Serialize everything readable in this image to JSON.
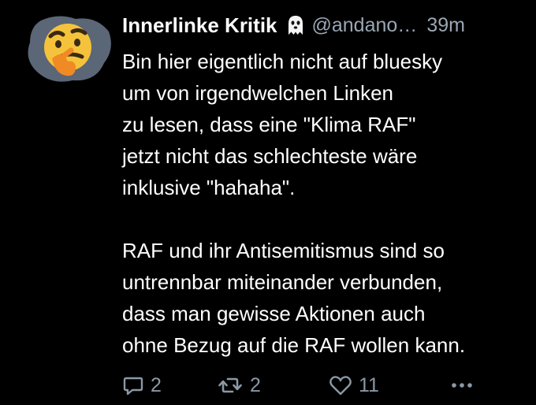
{
  "post": {
    "author": {
      "display_name": "Innerlinke Kritik",
      "badge_icon": "ghost-icon",
      "handle": "@andano…"
    },
    "time_ago": "39m",
    "paragraphs": [
      {
        "lines": [
          "Bin hier eigentlich nicht auf bluesky",
          "um von irgendwelchen Linken",
          "zu lesen, dass eine \"Klima RAF\"",
          "jetzt nicht das schlechteste wäre",
          "inklusive \"hahaha\"."
        ]
      },
      {
        "lines": [
          "RAF und ihr Antisemitismus sind so",
          "untrennbar miteinander verbunden,",
          "dass man gewisse Aktionen auch",
          "ohne Bezug auf die RAF wollen kann."
        ]
      }
    ],
    "actions": {
      "reply": {
        "icon": "reply-icon",
        "count": "2"
      },
      "repost": {
        "icon": "repost-icon",
        "count": "2"
      },
      "like": {
        "icon": "heart-icon",
        "count": "11"
      },
      "more": {
        "icon": "more-icon"
      }
    }
  },
  "colors": {
    "background": "#000000",
    "text": "#ffffff",
    "muted": "#9aa6b3",
    "avatar_bg": "#5b6676",
    "avatar_face": "#f5c33b",
    "avatar_hand": "#f08a24"
  }
}
